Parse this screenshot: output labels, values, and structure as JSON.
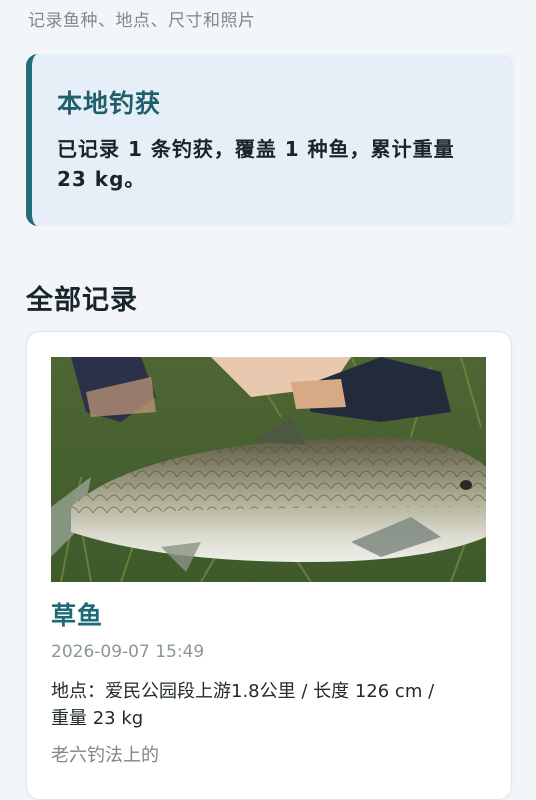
{
  "header": {
    "subtitle": "记录鱼种、地点、尺寸和照片"
  },
  "summary": {
    "title": "本地钓获",
    "text_line1": "已记录 1 条钓获，覆盖 1 种鱼，累计重量",
    "text_line2": "23 kg。"
  },
  "records_section": {
    "title": "全部记录"
  },
  "records": [
    {
      "species": "草鱼",
      "datetime": "2026-09-07 15:49",
      "detail_line1": "地点：爱民公园段上游1.8公里 / 长度 126 cm /",
      "detail_line2": "重量 23 kg",
      "note": "老六钓法上的",
      "photo_subject": "grass-carp-photo"
    }
  ],
  "colors": {
    "accent": "#226d7a",
    "summary_bg": "#e6eef7",
    "page_bg": "#f3f6f8"
  }
}
